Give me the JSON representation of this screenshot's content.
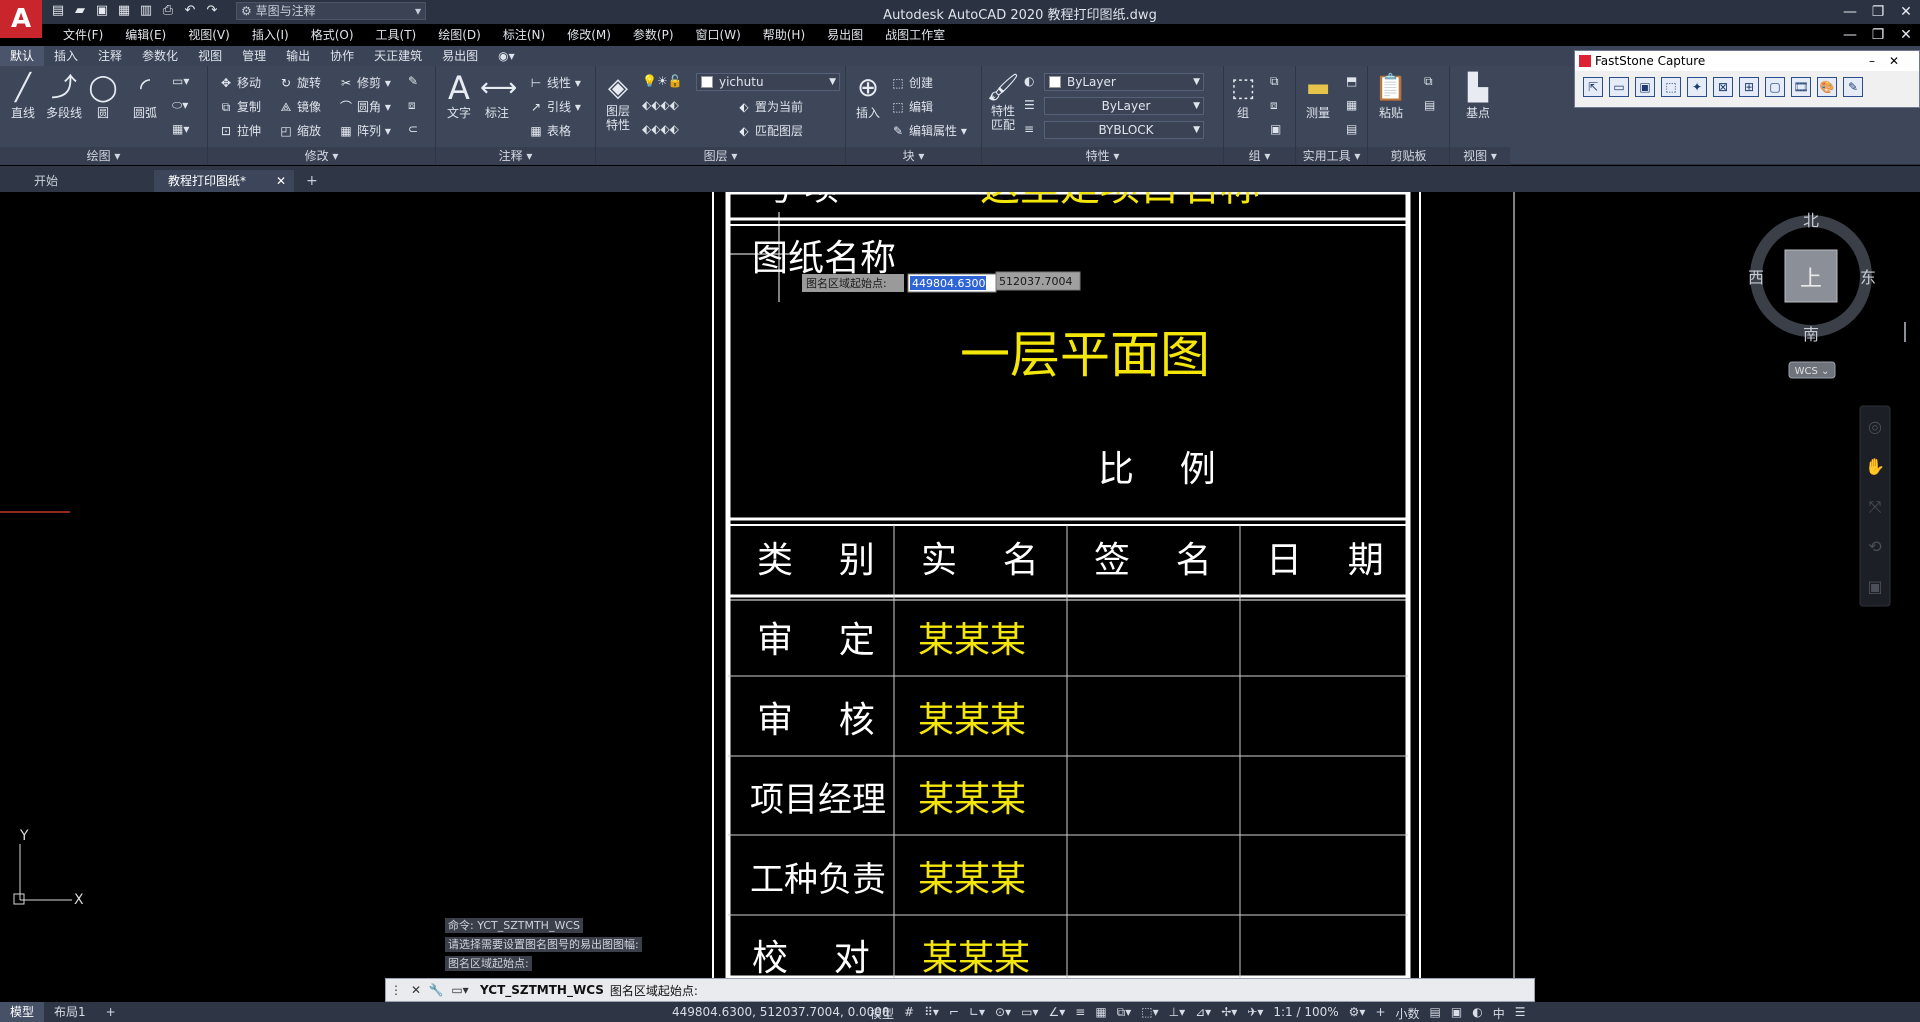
{
  "titlebar": {
    "app_logo": "A",
    "workspace": "草图与注释",
    "title": "Autodesk AutoCAD 2020    教程打印图纸.dwg",
    "window_controls": [
      "—",
      "❐",
      "✕"
    ]
  },
  "menubar": {
    "items": [
      "文件(F)",
      "编辑(E)",
      "视图(V)",
      "插入(I)",
      "格式(O)",
      "工具(T)",
      "绘图(D)",
      "标注(N)",
      "修改(M)",
      "参数(P)",
      "窗口(W)",
      "帮助(H)",
      "易出图",
      "战图工作室"
    ]
  },
  "ribbon_tabs": [
    "默认",
    "插入",
    "注释",
    "参数化",
    "视图",
    "管理",
    "输出",
    "协作",
    "天正建筑",
    "易出图"
  ],
  "ribbon": {
    "draw": {
      "title": "绘图 ▾",
      "line": "直线",
      "polyline": "多段线",
      "circle": "圆",
      "arc": "圆弧"
    },
    "modify": {
      "title": "修改 ▾",
      "move": "移动",
      "rotate": "旋转",
      "trim": "修剪",
      "copy": "复制",
      "mirror": "镜像",
      "fillet": "圆角",
      "stretch": "拉伸",
      "scale": "缩放",
      "array": "阵列"
    },
    "annotation": {
      "title": "注释 ▾",
      "text": "文字",
      "dimension": "标注",
      "linear": "线性",
      "leader": "引线",
      "table": "表格"
    },
    "layers": {
      "title": "图层 ▾",
      "props": "图层\n特性",
      "current_layer": "yichutu",
      "set_current": "置为当前",
      "match_layer": "匹配图层"
    },
    "block": {
      "title": "块 ▾",
      "insert": "插入",
      "create": "创建",
      "edit": "编辑",
      "edit_attr": "编辑属性"
    },
    "properties": {
      "title": "特性 ▾",
      "match": "特性\n匹配",
      "color": "ByLayer",
      "linetype": "ByLayer",
      "lineweight": "BYBLOCK"
    },
    "groups": {
      "title": "组 ▾",
      "group": "组"
    },
    "utilities": {
      "title": "实用工具 ▾",
      "measure": "测量"
    },
    "clipboard": {
      "title": "剪贴板",
      "paste": "粘贴"
    },
    "view": {
      "title": "视图 ▾",
      "base": "基点"
    }
  },
  "faststone": {
    "title": "FastStone Capture",
    "tools": [
      "⇱",
      "▭",
      "▣",
      "⬚",
      "✦",
      "⊠",
      "⊞",
      "▢",
      "🎞",
      "🎨",
      "✎"
    ]
  },
  "file_tabs": {
    "start": "开始",
    "current": "教程打印图纸*",
    "close": "✕",
    "new": "+"
  },
  "drawing": {
    "top_cut_text": "这里是项目名称",
    "top_cut_label": "号  项",
    "drawing_name_label": "图纸名称",
    "drawing_title": "一层平面图",
    "scale_label": "比    例",
    "headers": [
      "类    别",
      "实    名",
      "签    名",
      "日    期"
    ],
    "rows": [
      {
        "category": "审    定",
        "name": "某某某"
      },
      {
        "category": "审    核",
        "name": "某某某"
      },
      {
        "category": "项目经理",
        "name": "某某某"
      },
      {
        "category": "工种负责",
        "name": "某某某"
      },
      {
        "category": "校    对",
        "name": "某某某"
      }
    ],
    "input_prompt": "图名区域起始点:",
    "input_x": "449804.6300",
    "input_y": "512037.7004"
  },
  "viewcube": {
    "north": "北",
    "south": "南",
    "east": "东",
    "west": "西",
    "face": "上",
    "wcs": "WCS ⌄"
  },
  "ucs": {
    "x": "X",
    "y": "Y"
  },
  "command": {
    "history": [
      "命令: YCT_SZTMTH_WCS",
      "请选择需要设置图名图号的易出图图幅:",
      "图名区域起始点:"
    ],
    "current": "YCT_SZTMTH_WCS",
    "prompt": "图名区域起始点:"
  },
  "statusbar": {
    "tabs": [
      "模型",
      "布局1",
      "+"
    ],
    "coords": "449804.6300, 512037.7004, 0.0000",
    "mode": "模型",
    "scale": "1:1 / 100%",
    "units": "小数",
    "ime": "中"
  }
}
